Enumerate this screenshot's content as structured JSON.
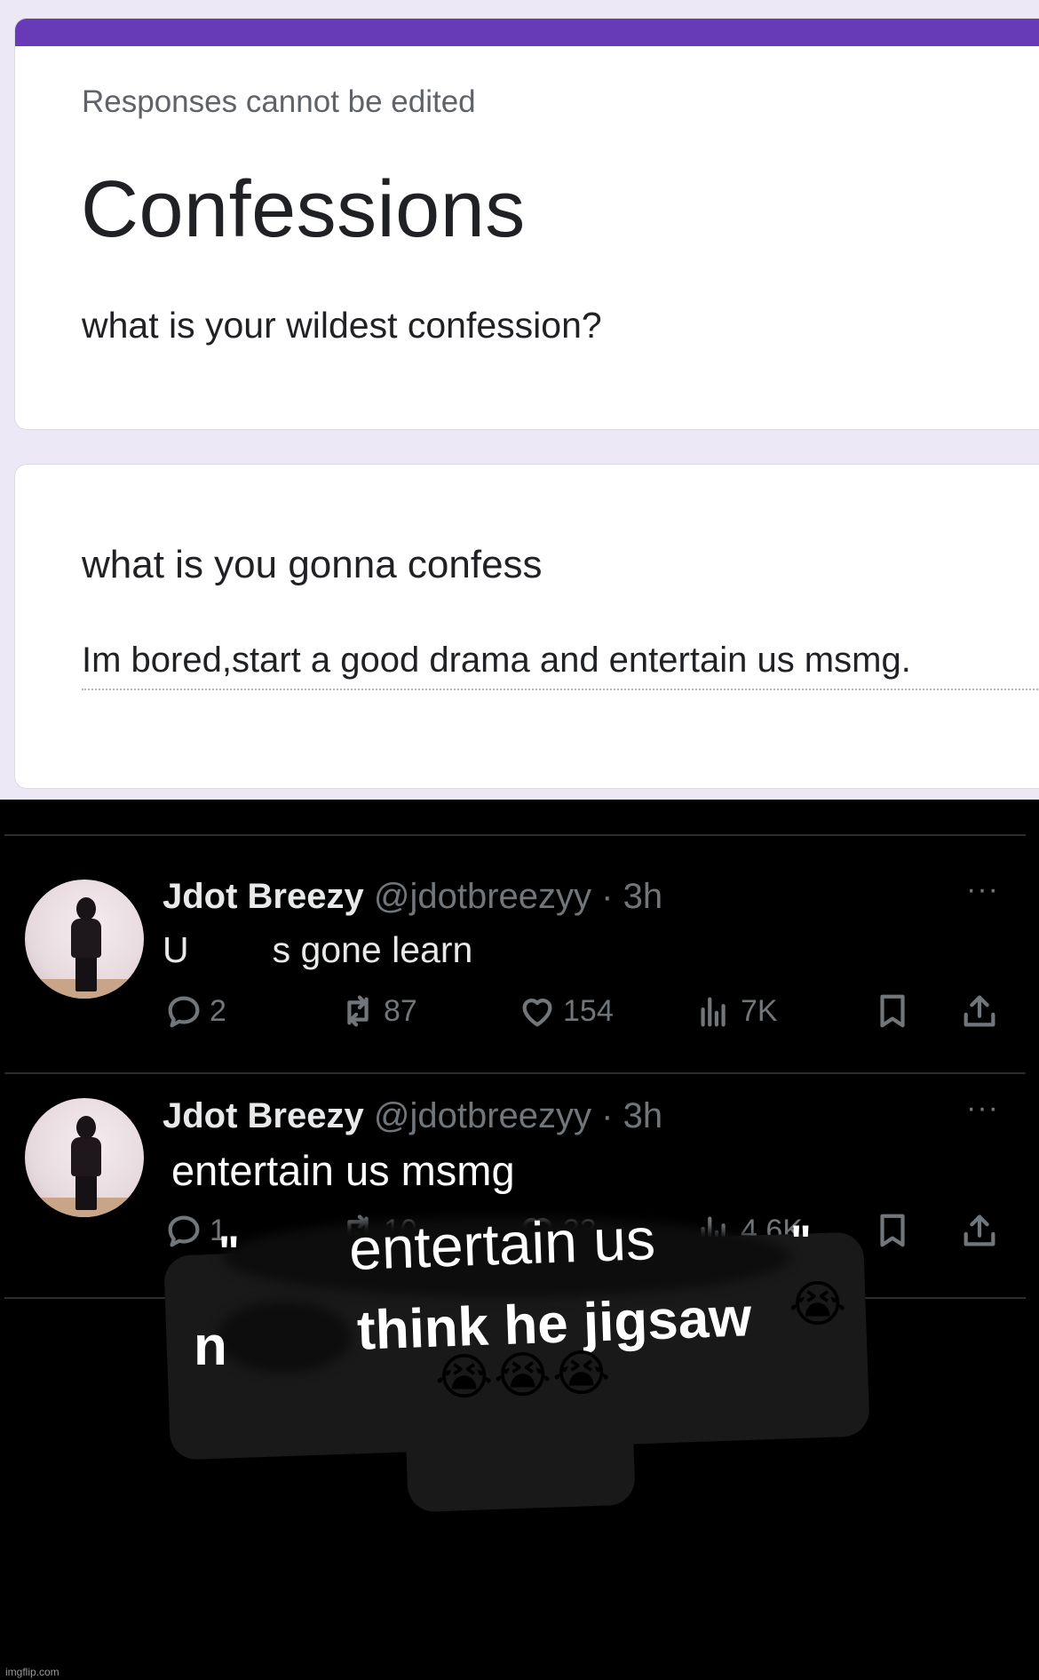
{
  "form": {
    "responses_note": "Responses cannot be edited",
    "title": "Confessions",
    "description": "what is your wildest confession?",
    "question": {
      "title": "what is you gonna confess",
      "answer": "Im bored,start a good drama and entertain us msmg."
    },
    "accent_color": "#673ab7"
  },
  "tweets": [
    {
      "name": "Jdot Breezy",
      "handle": "@jdotbreezyy",
      "time": "· 3h",
      "more": "···",
      "text_start": "U",
      "text_end": "s gone learn",
      "stats": {
        "replies": "2",
        "retweets": "87",
        "likes": "154",
        "views": "7K"
      }
    },
    {
      "name": "Jdot Breezy",
      "handle": "@jdotbreezyy",
      "time": "· 3h",
      "more": "···",
      "text": "entertain us msmg",
      "stats": {
        "replies": "1",
        "retweets": "10",
        "likes": "33",
        "views": "4.6K"
      }
    }
  ],
  "caption": {
    "quote_open": "\"",
    "line1": "entertain us",
    "quote_close": "\"",
    "line2_start": "n",
    "line2": "think he jigsaw",
    "emoji": "😭"
  },
  "watermark": "imgflip.com",
  "icons": [
    "reply-icon",
    "retweet-icon",
    "like-icon",
    "views-icon",
    "bookmark-icon",
    "share-icon",
    "more-icon",
    "loudly-crying-face-emoji"
  ]
}
